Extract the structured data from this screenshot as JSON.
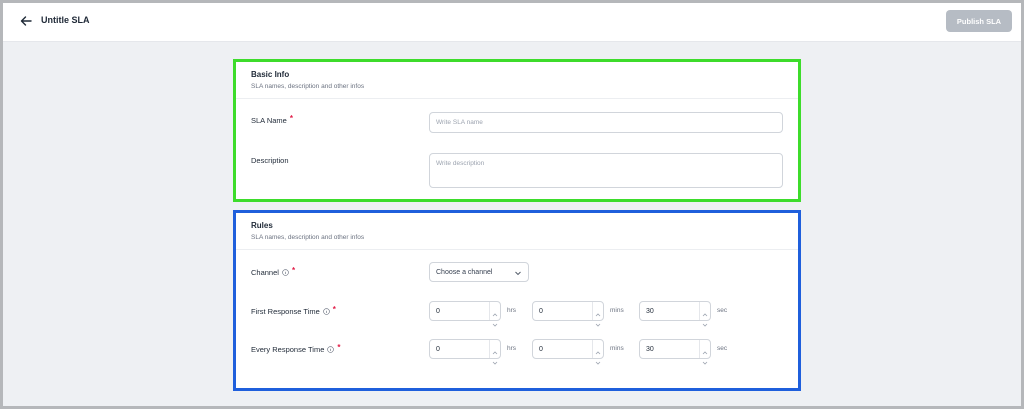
{
  "header": {
    "title": "Untitle SLA",
    "publish_label": "Publish SLA"
  },
  "basic_info": {
    "title": "Basic Info",
    "subtitle": "SLA names, description and other infos",
    "sla_name_label": "SLA Name",
    "sla_name_placeholder": "Write SLA name",
    "description_label": "Description",
    "description_placeholder": "Write description",
    "required_mark": "*"
  },
  "rules": {
    "title": "Rules",
    "subtitle": "SLA names, description and other infos",
    "channel_label": "Channel",
    "channel_value": "Choose a channel",
    "first_response_label": "First Response Time",
    "every_response_label": "Every Response Time",
    "required_mark": "*",
    "first_response": {
      "hrs": "0",
      "mins": "0",
      "sec": "30"
    },
    "every_response": {
      "hrs": "0",
      "mins": "0",
      "sec": "30"
    },
    "units": {
      "hrs": "hrs",
      "mins": "mins",
      "sec": "sec"
    }
  },
  "colors": {
    "basic_info_outline": "#3ddc2b",
    "rules_outline": "#1f5fdc",
    "required": "#e11d48",
    "publish_button_disabled": "#b6bcc4"
  },
  "icons": [
    "arrow-left-icon",
    "info-icon",
    "chevron-down-icon",
    "spinner-up-icon",
    "spinner-down-icon",
    "resize-grip-icon"
  ]
}
